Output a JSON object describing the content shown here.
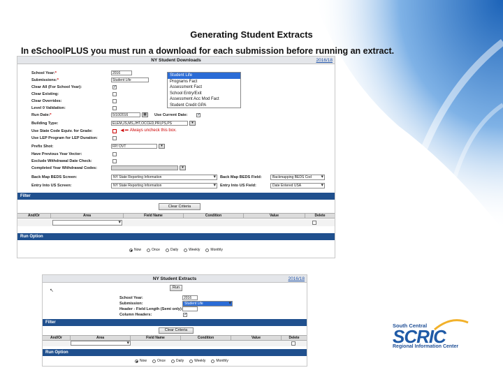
{
  "slide": {
    "title": "Generating Student Extracts",
    "subtitle": "In eSchoolPLUS you must run a download for each submission before running an extract."
  },
  "downloads": {
    "window_title": "NY Student Downloads",
    "help": "2016/18",
    "fields": {
      "school_year": {
        "label": "School Year:",
        "required": "*",
        "value": "2016"
      },
      "submissions": {
        "label": "Submissions:",
        "required": "*",
        "value": "Student Life"
      },
      "clear_all": {
        "label": "Clear All (For School Year):",
        "checked": true
      },
      "clear_existing": {
        "label": "Clear Existing:",
        "checked": false
      },
      "clear_overrides": {
        "label": "Clear Overrides:",
        "checked": false
      },
      "level0": {
        "label": "Level 0 Validation:",
        "checked": false
      },
      "run_date": {
        "label": "Run Date:",
        "required": "*",
        "value": "5/10/2016"
      },
      "use_current_date": {
        "label": "Use Current Date:",
        "checked": true
      },
      "building_type": {
        "label": "Building Type:",
        "value": "ELEM,JS,MS,JHT,OCCED,PRI,PS,PS"
      },
      "state_code": {
        "label": "Use State Code Equiv. for Grade:",
        "checked": false
      },
      "lep_program": {
        "label": "Use LEP Program for LEP Duration:",
        "checked": false
      },
      "prefix_shot": {
        "label": "Prefix Shot:",
        "value": "FP/ OVT"
      },
      "prev_year_vector": {
        "label": "Have Previous Year Vector:",
        "checked": false
      },
      "exclude_withdrawal": {
        "label": "Exclude Withdrawal Date Check:",
        "checked": false
      },
      "completed_year": {
        "label": "Completed Year Withdrawal Codes:",
        "value": ""
      },
      "back_map_screen": {
        "label": "Back Map BEDS Screen:",
        "value": "NY State Reporting Information"
      },
      "back_map_field": {
        "label": "Back Map BEDS Field:",
        "value": "Backmapping BEDS Cod"
      },
      "entry_us_screen": {
        "label": "Entry Into US Screen:",
        "value": "NY State Reporting Information"
      },
      "entry_us_field": {
        "label": "Entry Into US Field:",
        "value": "Date Entered USA"
      }
    },
    "submission_list": [
      "Student Life",
      "Programs Fact",
      "Assessment Fact",
      "School Entry/Exit",
      "Assessment Acc Mod Fact",
      "Student Credit GPA"
    ],
    "annotation": "Always uncheck this box.",
    "filter": {
      "title": "Filter",
      "clear_button": "Clear Criteria",
      "columns": [
        "And/Or",
        "Area",
        "Field Name",
        "Condition",
        "Value",
        "Delete"
      ]
    },
    "run_option": {
      "title": "Run Option",
      "options": [
        "Now",
        "Once",
        "Daily",
        "Weekly",
        "Monthly"
      ],
      "selected": "Now"
    }
  },
  "extracts": {
    "window_title": "NY Student Extracts",
    "help": "2016/18",
    "run_button": "Run",
    "fields": {
      "school_year": {
        "label": "School Year:",
        "value": "2016"
      },
      "submission": {
        "label": "Submission:",
        "value": "Student Life"
      },
      "header": {
        "label": "Header - Field Length (Semi only):",
        "value": ""
      },
      "column_headers": {
        "label": "Column Headers:",
        "checked": true
      }
    },
    "filter": {
      "title": "Filter",
      "clear_button": "Clear Criteria",
      "columns": [
        "And/Or",
        "Area",
        "Field Name",
        "Condition",
        "Value",
        "Delete"
      ]
    },
    "run_option": {
      "title": "Run Option",
      "options": [
        "Now",
        "Once",
        "Daily",
        "Weekly",
        "Monthly"
      ],
      "selected": "Now"
    }
  },
  "logo": {
    "top": "South Central",
    "main": "SCRIC",
    "bottom": "Regional Information Center",
    "color": "#1f5aa6"
  },
  "colors": {
    "section_bar": "#20508e",
    "accent_sweep": "#3b86d6"
  }
}
